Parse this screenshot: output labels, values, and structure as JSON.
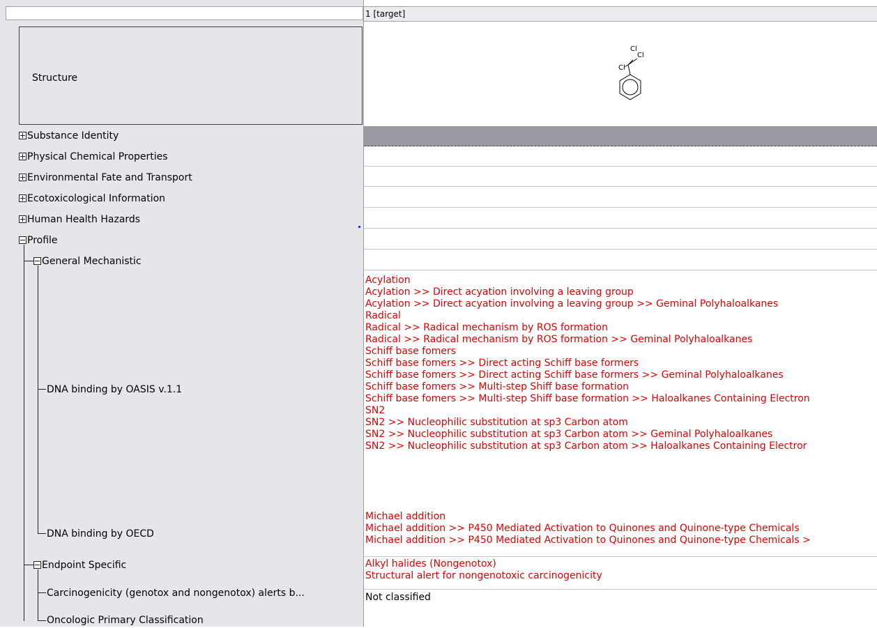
{
  "header": {
    "column_label": "1 [target]"
  },
  "structure": {
    "label": "Structure",
    "atoms": [
      "Cl",
      "Cl",
      "Cl"
    ]
  },
  "tree": {
    "substance_identity": "Substance Identity",
    "physchem": "Physical Chemical Properties",
    "env_fate": "Environmental Fate and Transport",
    "ecotox": "Ecotoxicological Information",
    "human_health": "Human Health Hazards",
    "profile": "Profile",
    "general_mechanistic": "General Mechanistic",
    "dna_oasis": "DNA binding by OASIS v.1.1",
    "dna_oecd": "DNA binding by OECD",
    "endpoint_specific": "Endpoint Specific",
    "carcinogenicity": "Carcinogenicity (genotox and nongenotox) alerts b...",
    "oncologic": "Oncologic Primary Classification"
  },
  "values": {
    "dna_oasis": [
      "Acylation",
      "Acylation >> Direct acyation involving a leaving group",
      "Acylation >> Direct acyation involving a leaving group >> Geminal Polyhaloalkanes",
      "Radical",
      "Radical >> Radical mechanism by ROS formation",
      "Radical >> Radical mechanism by ROS formation >> Geminal Polyhaloalkanes",
      "Schiff base fomers",
      "Schiff base fomers >> Direct acting Schiff base formers",
      "Schiff base fomers >> Direct acting Schiff base formers >> Geminal Polyhaloalkanes",
      "Schiff base fomers >> Multi-step Shiff base formation",
      "Schiff base fomers >> Multi-step Shiff base formation >> Haloalkanes Containing Electron",
      "SN2",
      "SN2 >> Nucleophilic substitution at sp3 Carbon atom",
      "SN2 >> Nucleophilic substitution at sp3 Carbon atom >> Geminal Polyhaloalkanes",
      "SN2 >> Nucleophilic substitution at sp3 Carbon atom >> Haloalkanes Containing Electror"
    ],
    "dna_oecd": [
      "Michael addition",
      "Michael addition >> P450 Mediated Activation to Quinones and Quinone-type Chemicals",
      "Michael addition >> P450 Mediated Activation to Quinones and Quinone-type Chemicals >"
    ],
    "carcinogenicity": [
      "Alkyl halides (Nongenotox)",
      "Structural alert for nongenotoxic carcinogenicity"
    ],
    "oncologic": "Not classified"
  },
  "colors": {
    "alert_text": "#e00000",
    "panel_bg": "#e6e6ea",
    "selected_row": "#9a9aa2"
  }
}
